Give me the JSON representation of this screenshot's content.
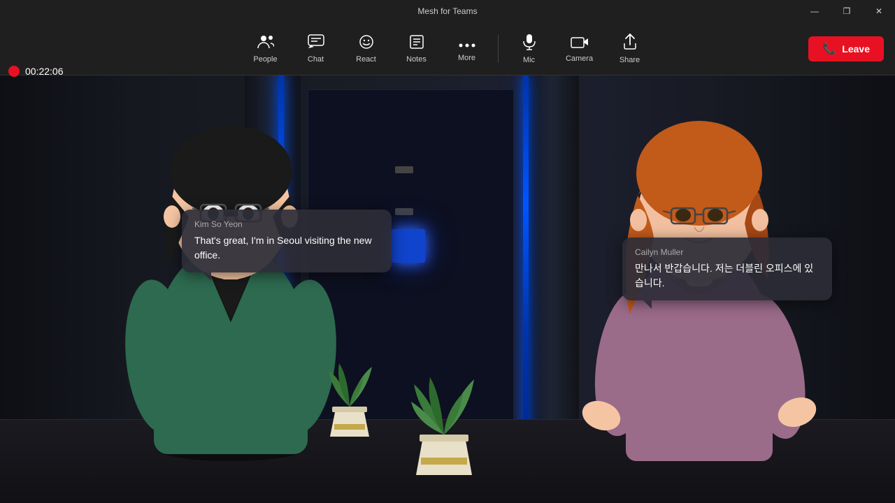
{
  "titlebar": {
    "title": "Mesh for Teams",
    "controls": {
      "minimize": "—",
      "maximize": "❐",
      "close": "✕"
    }
  },
  "recording": {
    "time": "00:22:06"
  },
  "toolbar": {
    "buttons": [
      {
        "id": "people",
        "label": "People",
        "icon": "👥"
      },
      {
        "id": "chat",
        "label": "Chat",
        "icon": "💬"
      },
      {
        "id": "react",
        "label": "React",
        "icon": "😊"
      },
      {
        "id": "notes",
        "label": "Notes",
        "icon": "📋"
      },
      {
        "id": "more",
        "label": "More",
        "icon": "•••"
      },
      {
        "id": "mic",
        "label": "Mic",
        "icon": "🎤"
      },
      {
        "id": "camera",
        "label": "Camera",
        "icon": "📹"
      },
      {
        "id": "share",
        "label": "Share",
        "icon": "↑"
      }
    ],
    "leave_label": "Leave"
  },
  "bubbles": {
    "kim": {
      "name": "Kim So Yeon",
      "text": "That's great, I'm in Seoul visiting the new office."
    },
    "cailyn": {
      "name": "Cailyn Muller",
      "text": "만나서 반갑습니다. 저는 더블린 오피스에 있습니다."
    }
  }
}
